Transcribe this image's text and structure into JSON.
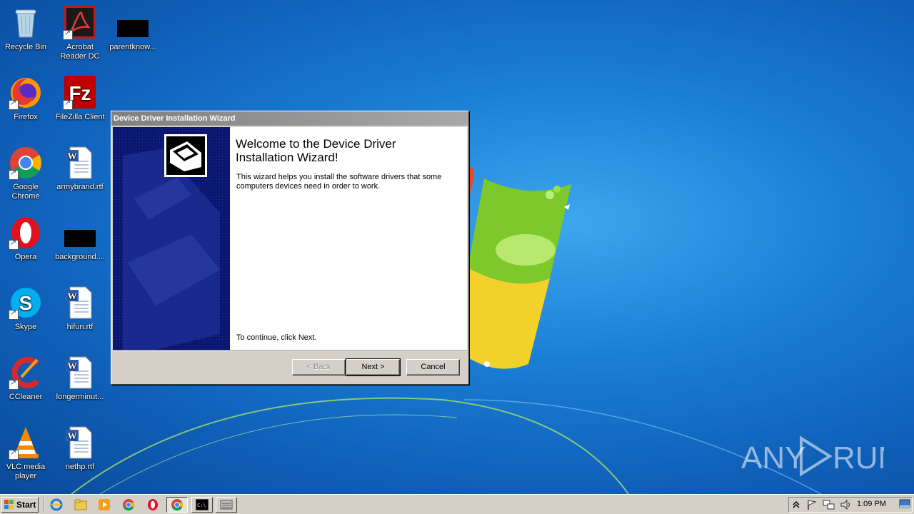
{
  "desktop": {
    "icons": [
      {
        "label": "Recycle Bin",
        "icon": "recycle-bin-icon"
      },
      {
        "label": "Acrobat Reader DC",
        "icon": "acrobat-icon"
      },
      {
        "label": "parentknow...",
        "icon": "black-file-icon"
      },
      {
        "label": "Firefox",
        "icon": "firefox-icon"
      },
      {
        "label": "FileZilla Client",
        "icon": "filezilla-icon"
      },
      {
        "label": "Google Chrome",
        "icon": "chrome-icon"
      },
      {
        "label": "armybrand.rtf",
        "icon": "word-doc-icon"
      },
      {
        "label": "Opera",
        "icon": "opera-icon"
      },
      {
        "label": "background....",
        "icon": "black-file-icon"
      },
      {
        "label": "Skype",
        "icon": "skype-icon"
      },
      {
        "label": "hifun.rtf",
        "icon": "word-doc-icon"
      },
      {
        "label": "CCleaner",
        "icon": "ccleaner-icon"
      },
      {
        "label": "longerminut...",
        "icon": "word-doc-icon"
      },
      {
        "label": "VLC media player",
        "icon": "vlc-icon"
      },
      {
        "label": "nethp.rtf",
        "icon": "word-doc-icon"
      }
    ]
  },
  "dialog": {
    "title": "Device Driver Installation Wizard",
    "heading": "Welcome to the Device Driver Installation Wizard!",
    "description": "This wizard helps you install the software drivers that some computers devices need in order to work.",
    "continue_text": "To continue, click Next.",
    "back_label": "< Back",
    "next_label": "Next >",
    "cancel_label": "Cancel"
  },
  "watermark": {
    "text": "ANY RUN"
  },
  "taskbar": {
    "start_label": "Start",
    "quick_launch": [
      "ie-icon",
      "folder-icon",
      "media-player-icon",
      "chrome-icon",
      "opera-icon"
    ],
    "tasks": [
      "chrome-task-icon",
      "cmd-task-icon",
      "wizard-task-icon"
    ],
    "clock": "1:09 PM"
  },
  "colors": {
    "desktop_blue": "#1b7fd6",
    "wizard_side_navy": "#0a1670",
    "dialog_gray": "#d4d0c8",
    "titlebar_gray": "#808080"
  }
}
